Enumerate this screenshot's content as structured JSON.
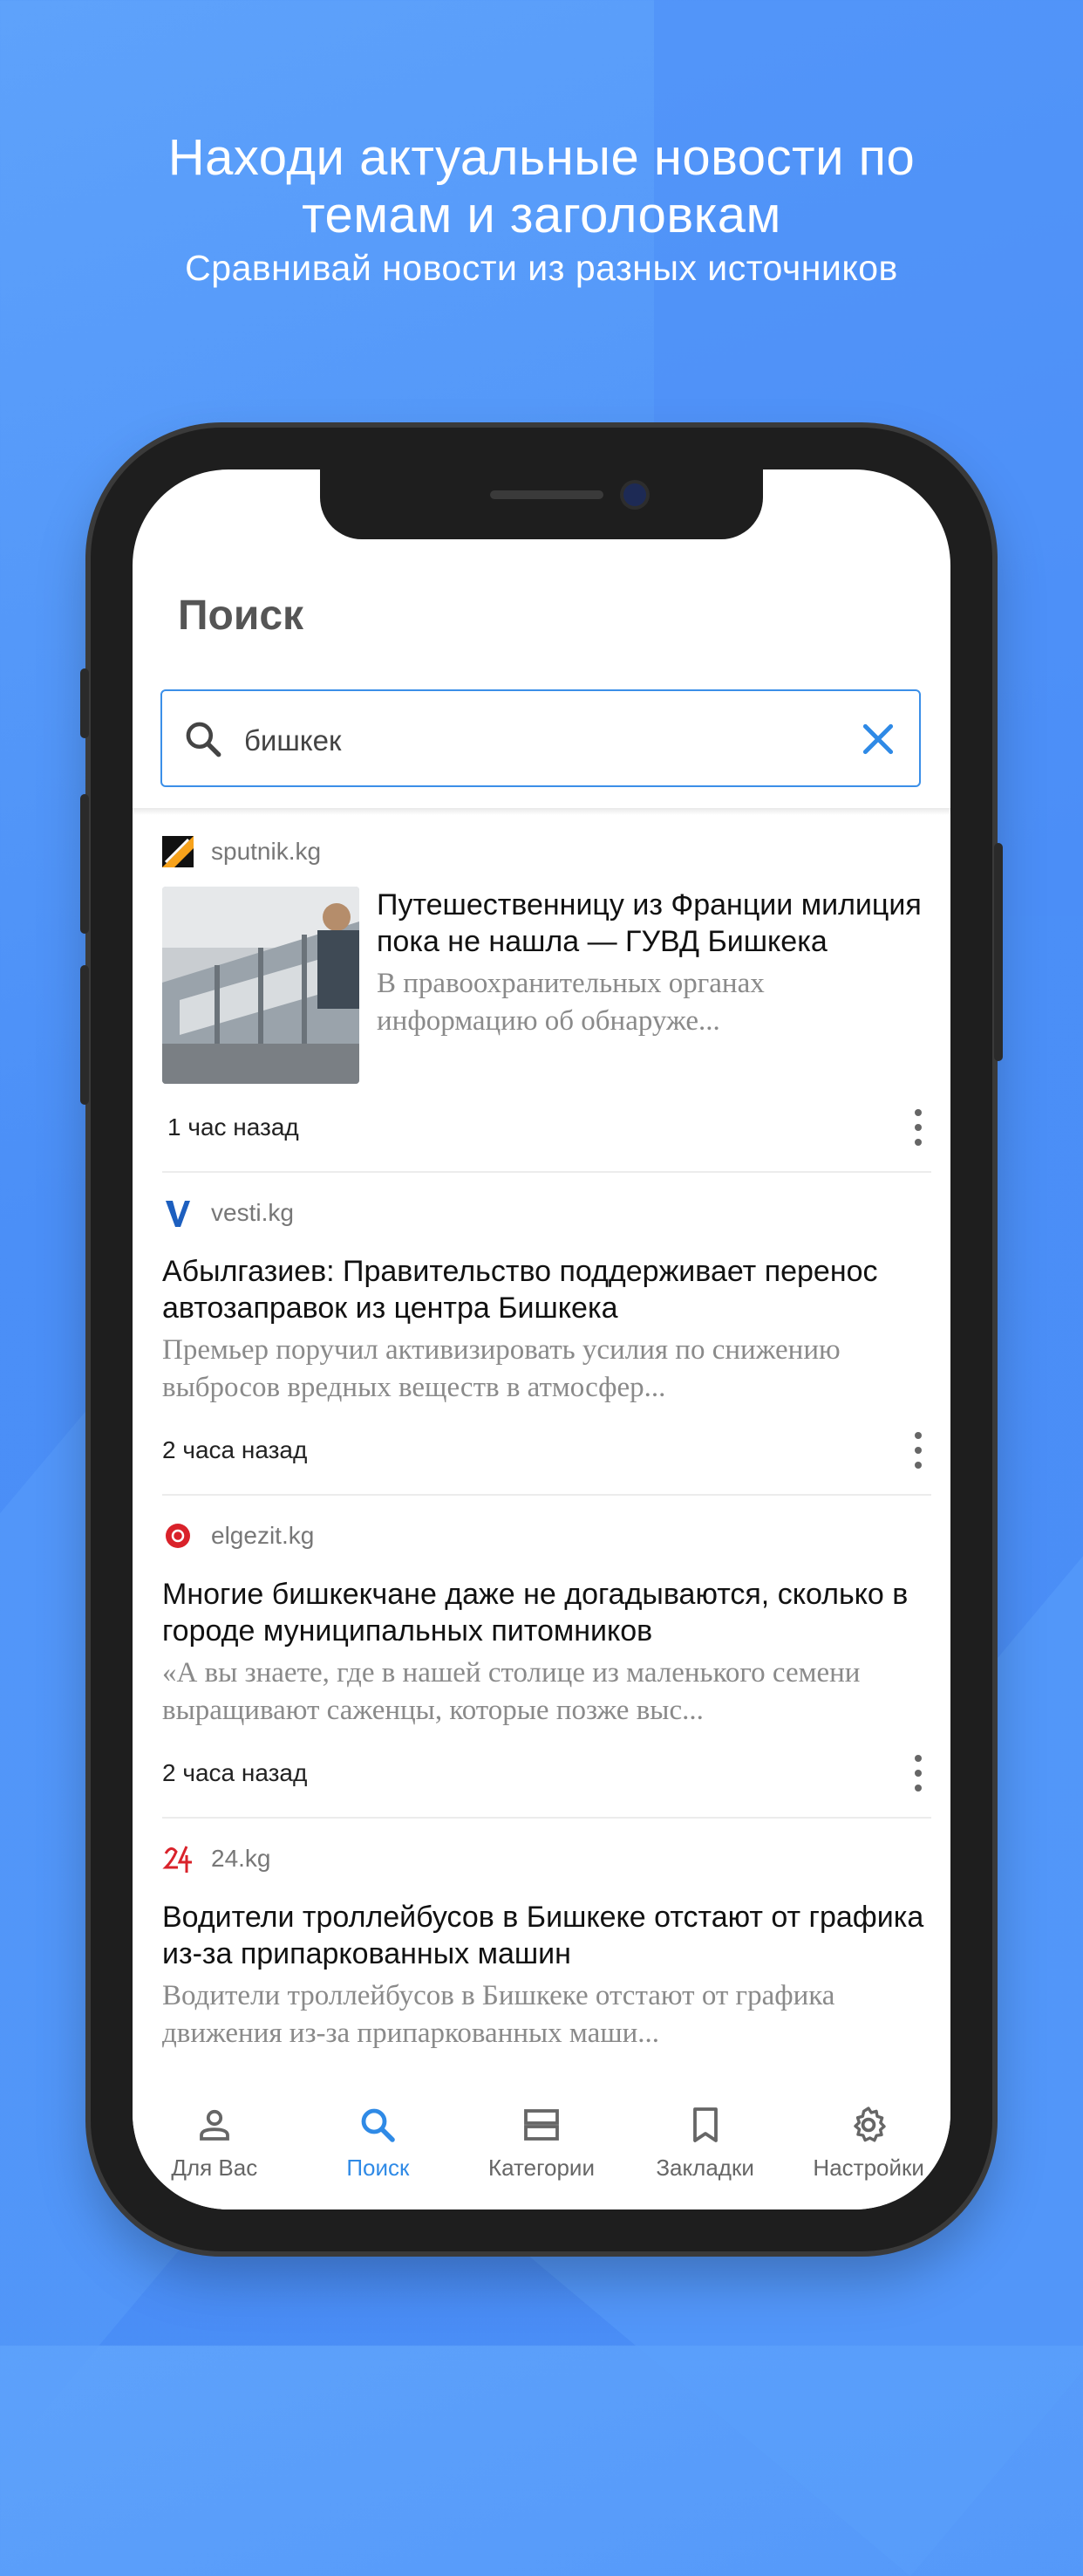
{
  "promo": {
    "title_line1": "Находи актуальные новости по",
    "title_line2": "темам и заголовкам",
    "subtitle": "Сравнивай новости из разных источников"
  },
  "screen": {
    "title": "Поиск",
    "search": {
      "value": "бишкек",
      "search_icon": "search-icon",
      "clear_icon": "close-icon"
    }
  },
  "articles": [
    {
      "source": "sputnik.kg",
      "logo_icon": "sputnik-logo",
      "title": "Путешественницу из Франции милиция пока не нашла — ГУВД Бишкека",
      "description": "В правоохранительных органах информацию об обнаруже...",
      "time": "1 час назад",
      "has_image": true
    },
    {
      "source": "vesti.kg",
      "logo_icon": "vesti-logo",
      "title": "Абылгазиев: Правительство поддерживает перенос автозаправок из центра Бишкека",
      "description": "Премьер поручил активизировать усилия по снижению выбросов вредных веществ в атмосфер...",
      "time": "2 часа назад",
      "has_image": false
    },
    {
      "source": "elgezit.kg",
      "logo_icon": "elgezit-logo",
      "title": "Многие бишкекчане даже не догадываются, сколько в городе муниципальных питомников",
      "description": "«А вы знаете, где в нашей столице из маленького семени выращивают саженцы, которые позже выс...",
      "time": "2 часа назад",
      "has_image": false
    },
    {
      "source": "24.kg",
      "logo_icon": "24kg-logo",
      "title": "Водители троллейбусов в Бишкеке отстают от графика из-за припаркованных машин",
      "description": "Водители троллейбусов в Бишкеке отстают от графика движения из-за припаркованных маши...",
      "time": "",
      "has_image": false
    }
  ],
  "bottom_nav": [
    {
      "label": "Для Вас",
      "icon": "person-icon",
      "active": false
    },
    {
      "label": "Поиск",
      "icon": "search-icon",
      "active": true
    },
    {
      "label": "Категории",
      "icon": "categories-icon",
      "active": false
    },
    {
      "label": "Закладки",
      "icon": "bookmark-icon",
      "active": false
    },
    {
      "label": "Настройки",
      "icon": "gear-icon",
      "active": false
    }
  ],
  "colors": {
    "accent": "#2f8ae6",
    "background": "#4a8df6",
    "inactive": "#666666"
  }
}
